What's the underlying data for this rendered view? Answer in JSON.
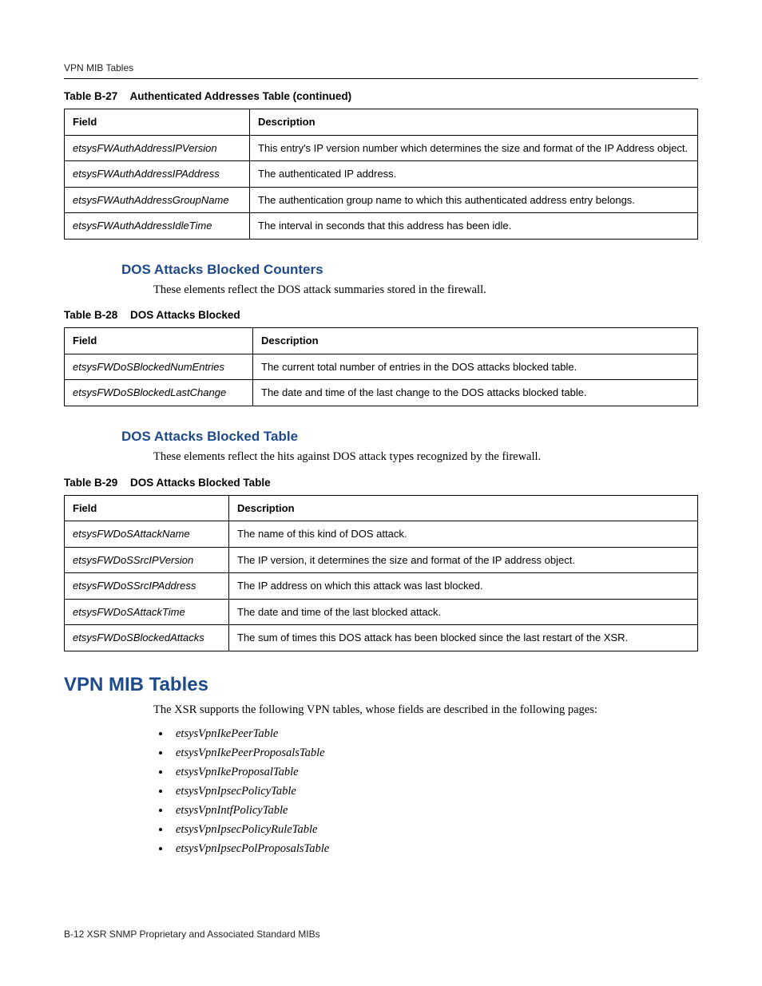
{
  "running_head": "VPN MIB Tables",
  "tables": {
    "t27": {
      "caption_num": "Table B-27",
      "caption_title": "Authenticated Addresses Table (continued)",
      "col_field": "Field",
      "col_desc": "Description",
      "rows": [
        {
          "field": "etsysFWAuthAddressIPVersion",
          "desc": "This entry's IP version number which determines the size and format of the IP Address object."
        },
        {
          "field": "etsysFWAuthAddressIPAddress",
          "desc": "The authenticated IP address."
        },
        {
          "field": "etsysFWAuthAddressGroupName",
          "desc": "The authentication group name to which this authenticated address entry belongs."
        },
        {
          "field": "etsysFWAuthAddressIdleTime",
          "desc": "The interval in seconds that this address has been idle."
        }
      ]
    },
    "t28": {
      "caption_num": "Table B-28",
      "caption_title": "DOS Attacks Blocked",
      "col_field": "Field",
      "col_desc": "Description",
      "rows": [
        {
          "field": "etsysFWDoSBlockedNumEntries",
          "desc": "The current total number of entries in the DOS attacks blocked table."
        },
        {
          "field": "etsysFWDoSBlockedLastChange",
          "desc": "The date and time of the last change to the DOS attacks blocked table."
        }
      ]
    },
    "t29": {
      "caption_num": "Table B-29",
      "caption_title": "DOS Attacks Blocked Table",
      "col_field": "Field",
      "col_desc": "Description",
      "rows": [
        {
          "field": "etsysFWDoSAttackName",
          "desc": "The name of this kind of DOS attack."
        },
        {
          "field": "etsysFWDoSSrcIPVersion",
          "desc": "The IP version, it determines the size and format of the IP address object."
        },
        {
          "field": "etsysFWDoSSrcIPAddress",
          "desc": "The IP address on which this attack was last blocked."
        },
        {
          "field": "etsysFWDoSAttackTime",
          "desc": "The date and time of the last blocked attack."
        },
        {
          "field": "etsysFWDoSBlockedAttacks",
          "desc": "The sum of times this DOS attack has been blocked since the last restart of the XSR."
        }
      ]
    }
  },
  "sections": {
    "counters": {
      "heading": "DOS Attacks Blocked Counters",
      "text": "These elements reflect the DOS attack summaries stored in the firewall."
    },
    "blocked_table": {
      "heading": "DOS Attacks Blocked Table",
      "text": "These elements reflect the hits against DOS attack types recognized by the firewall."
    },
    "vpn": {
      "heading": "VPN MIB Tables",
      "text": "The XSR supports the following VPN tables, whose fields are described in the following pages:",
      "items": [
        "etsysVpnIkePeerTable",
        "etsysVpnIkePeerProposalsTable",
        "etsysVpnIkeProposalTable",
        "etsysVpnIpsecPolicyTable",
        "etsysVpnIntfPolicyTable",
        "etsysVpnIpsecPolicyRuleTable",
        "etsysVpnIpsecPolProposalsTable"
      ]
    }
  },
  "footer": "B-12  XSR SNMP Proprietary and Associated Standard MIBs"
}
